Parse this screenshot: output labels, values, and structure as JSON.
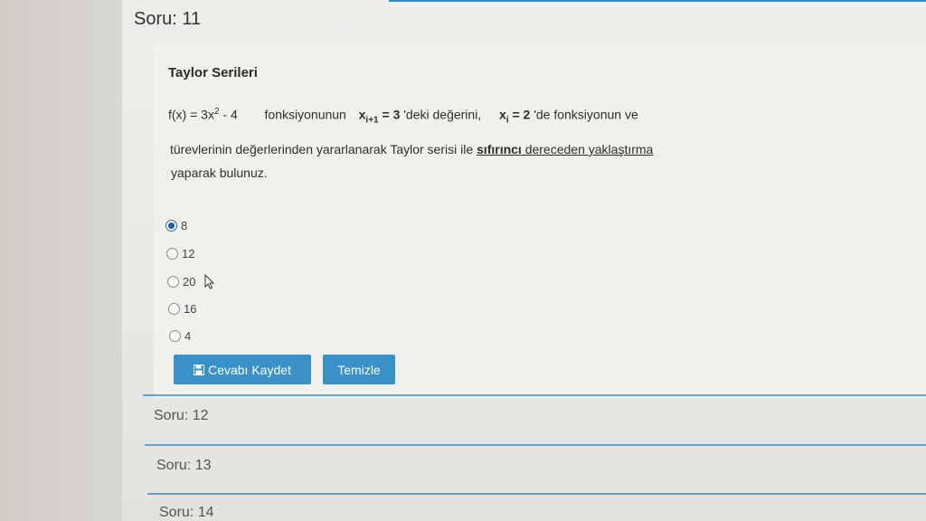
{
  "current_question": {
    "header": "Soru: 11",
    "title": "Taylor Serileri",
    "line1": {
      "f_text": "f(x) = 3x",
      "f_exp": "2",
      "f_tail": " - 4",
      "mid": "fonksiyonunun",
      "x1": "x",
      "x1_sub": "i+1",
      "x1_val": " = 3",
      "deki": " 'deki  değerini,",
      "x2": "x",
      "x2_sub": "i",
      "x2_val": " = 2",
      "de": " 'de   fonksiyonun ve"
    },
    "line2_pre": "türevlerinin değerlerinden yararlanarak Taylor serisi ile ",
    "line2_bold": "sıfırıncı",
    "line2_post": " dereceden yaklaştırma",
    "line3": "yaparak bulunuz."
  },
  "options": [
    {
      "label": "8",
      "selected": true
    },
    {
      "label": "12",
      "selected": false
    },
    {
      "label": "20",
      "selected": false
    },
    {
      "label": "16",
      "selected": false
    },
    {
      "label": "4",
      "selected": false
    }
  ],
  "buttons": {
    "save_label": "Cevabı Kaydet",
    "clear_label": "Temizle"
  },
  "other_questions": [
    "Soru: 12",
    "Soru: 13",
    "Soru: 14"
  ],
  "colors": {
    "accent": "#3a91c7",
    "divider": "#5fa3cf"
  },
  "icons": {
    "save": "floppy-disk-icon",
    "cursor": "mouse-pointer-icon"
  }
}
